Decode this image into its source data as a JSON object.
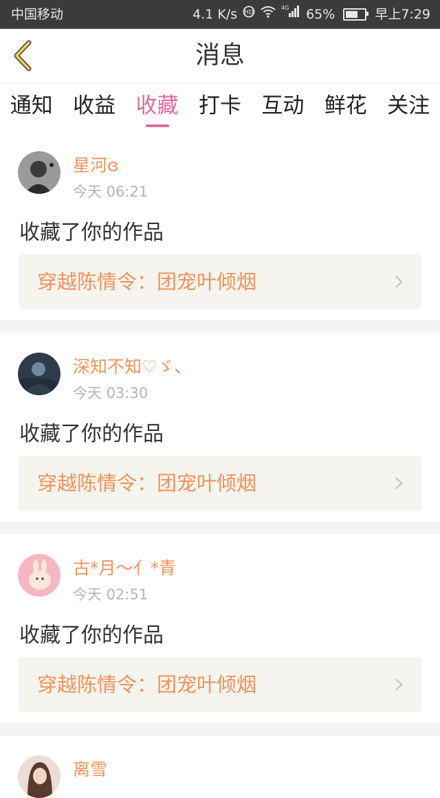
{
  "statusbar": {
    "carrier": "中国移动",
    "speed": "4.1 K/s",
    "network": "4G",
    "battery": "65%",
    "battery_level": 0.65,
    "time": "早上7:29"
  },
  "navbar": {
    "title": "消息"
  },
  "tabs": [
    {
      "label": "通知"
    },
    {
      "label": "收益"
    },
    {
      "label": "收藏"
    },
    {
      "label": "打卡"
    },
    {
      "label": "互动"
    },
    {
      "label": "鲜花"
    },
    {
      "label": "关注"
    }
  ],
  "active_tab": "收藏",
  "feed": [
    {
      "user": "星河ɞ",
      "time": "今天 06:21",
      "action": "收藏了你的作品",
      "work": "穿越陈情令：团宠叶倾烟"
    },
    {
      "user": "深知不知♡ゞ、",
      "time": "今天 03:30",
      "action": "收藏了你的作品",
      "work": "穿越陈情令：团宠叶倾烟"
    },
    {
      "user": "古*月～亻*青",
      "time": "今天 02:51",
      "action": "收藏了你的作品",
      "work": "穿越陈情令：团宠叶倾烟"
    },
    {
      "user": "离雪"
    }
  ],
  "colors": {
    "accent": "#e06aa0",
    "username": "#f0935a",
    "work_bg": "#f5f4ee",
    "statusbar_bg": "#3b3b3b"
  }
}
